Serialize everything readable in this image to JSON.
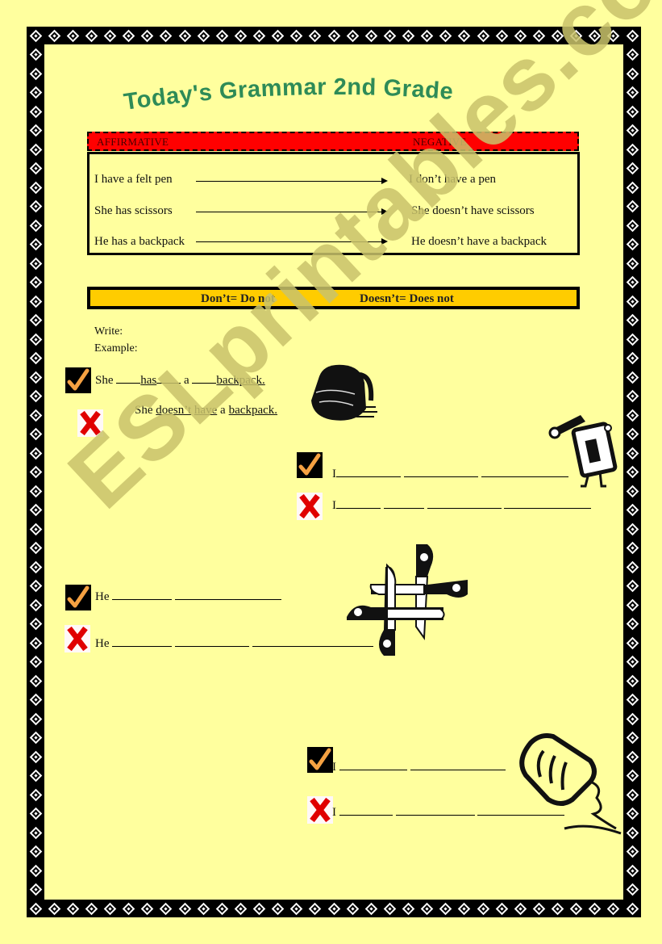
{
  "title": "Today's Grammar 2nd Grade",
  "colors": {
    "background": "#ffff9e",
    "title_green": "#2e8b57",
    "header_red": "#ff0000",
    "note_orange": "#ffcc00",
    "watermark": "#c9c36b"
  },
  "table": {
    "headers": {
      "affirmative": "AFFIRMATIVE",
      "negative": "NEGATIVE"
    },
    "rows": [
      {
        "affirmative": "I have a felt pen",
        "negative": "I don’t have a pen"
      },
      {
        "affirmative": "She has scissors",
        "negative": "She doesn’t have scissors"
      },
      {
        "affirmative": "He has a backpack",
        "negative": "He doesn’t have a backpack"
      }
    ]
  },
  "note": {
    "left": "Don’t= Do not",
    "right": "Doesn’t= Does not"
  },
  "instructions": {
    "write": "Write:",
    "example": "Example:"
  },
  "example": {
    "affirmative": {
      "subject": "She",
      "verb": "has",
      "article": "a",
      "object": "backpack."
    },
    "negative": {
      "subject": "She",
      "aux": "doesn’t",
      "verb": "have",
      "article": "a",
      "object": "backpack."
    }
  },
  "exercises": [
    {
      "picture": "pencil-sharpener",
      "affirmative_start": "I",
      "negative_start": "I"
    },
    {
      "picture": "scissors",
      "affirmative_start": "He",
      "negative_start": "He"
    },
    {
      "picture": "glue-bottle",
      "affirmative_start": "I",
      "negative_start": "I"
    }
  ],
  "icons": {
    "affirmative": "check-icon",
    "negative": "cross-icon"
  },
  "watermark": "ESLprintables.com"
}
